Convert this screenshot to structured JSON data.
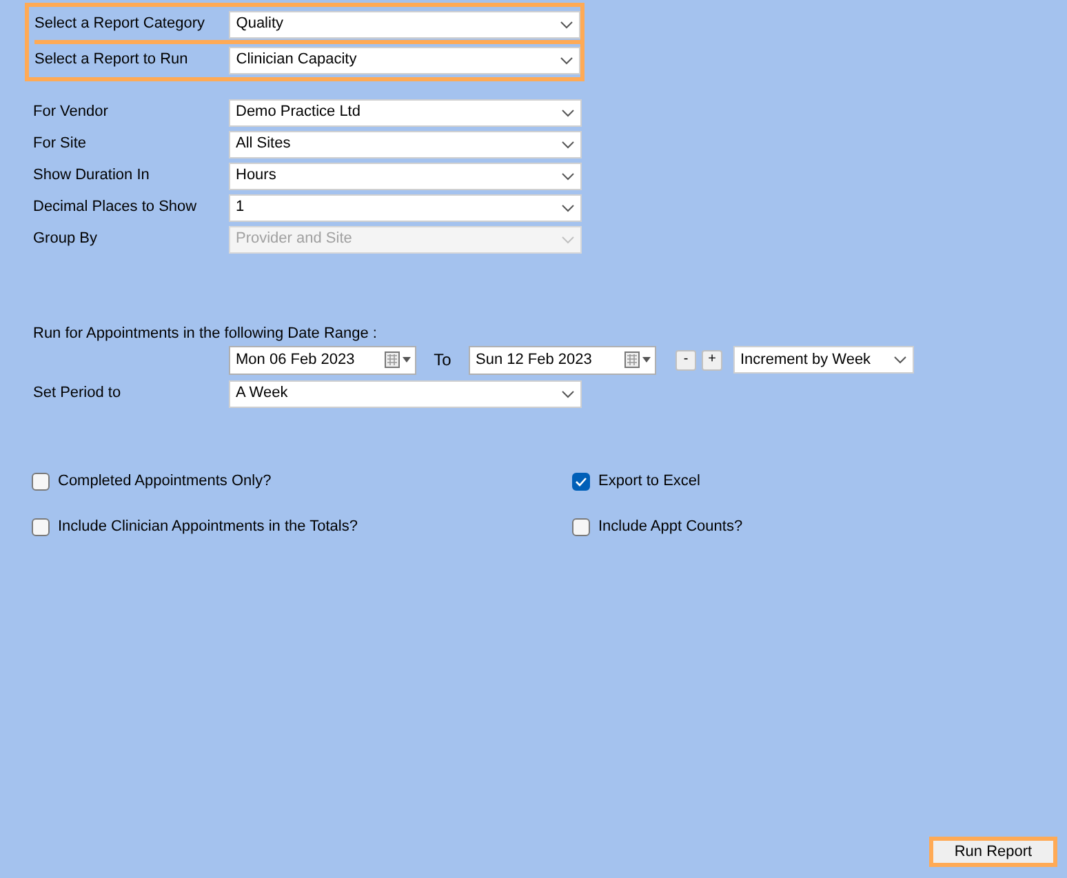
{
  "report_selection": {
    "highlighted": true,
    "fields": [
      {
        "label": "Select a Report Category",
        "value": "Quality",
        "disabled": false
      },
      {
        "label": "Select a Report to Run",
        "value": "Clinician Capacity",
        "disabled": false
      }
    ]
  },
  "options": [
    {
      "label": "For Vendor",
      "value": "Demo Practice Ltd",
      "disabled": false
    },
    {
      "label": "For Site",
      "value": "All Sites",
      "disabled": false
    },
    {
      "label": "Show Duration In",
      "value": "Hours",
      "disabled": false
    },
    {
      "label": "Decimal Places to Show",
      "value": "1",
      "disabled": false
    },
    {
      "label": "Group By",
      "value": "Provider and Site",
      "disabled": true
    }
  ],
  "date_range": {
    "label": "Run for Appointments in the following Date Range :",
    "from": "Mon 06 Feb 2023",
    "to_label": "To",
    "to": "Sun 12 Feb 2023",
    "minus": "-",
    "plus": "+",
    "increment": "Increment by Week"
  },
  "period": {
    "label": "Set Period to",
    "value": "A Week"
  },
  "checkboxes": [
    {
      "label": "Completed Appointments Only?",
      "checked": false
    },
    {
      "label": "Export to Excel",
      "checked": true
    },
    {
      "label": "Include Clinician Appointments in the Totals?",
      "checked": false
    },
    {
      "label": "Include Appt Counts?",
      "checked": false
    }
  ],
  "run_button": {
    "label": "Run Report",
    "highlighted": true
  }
}
